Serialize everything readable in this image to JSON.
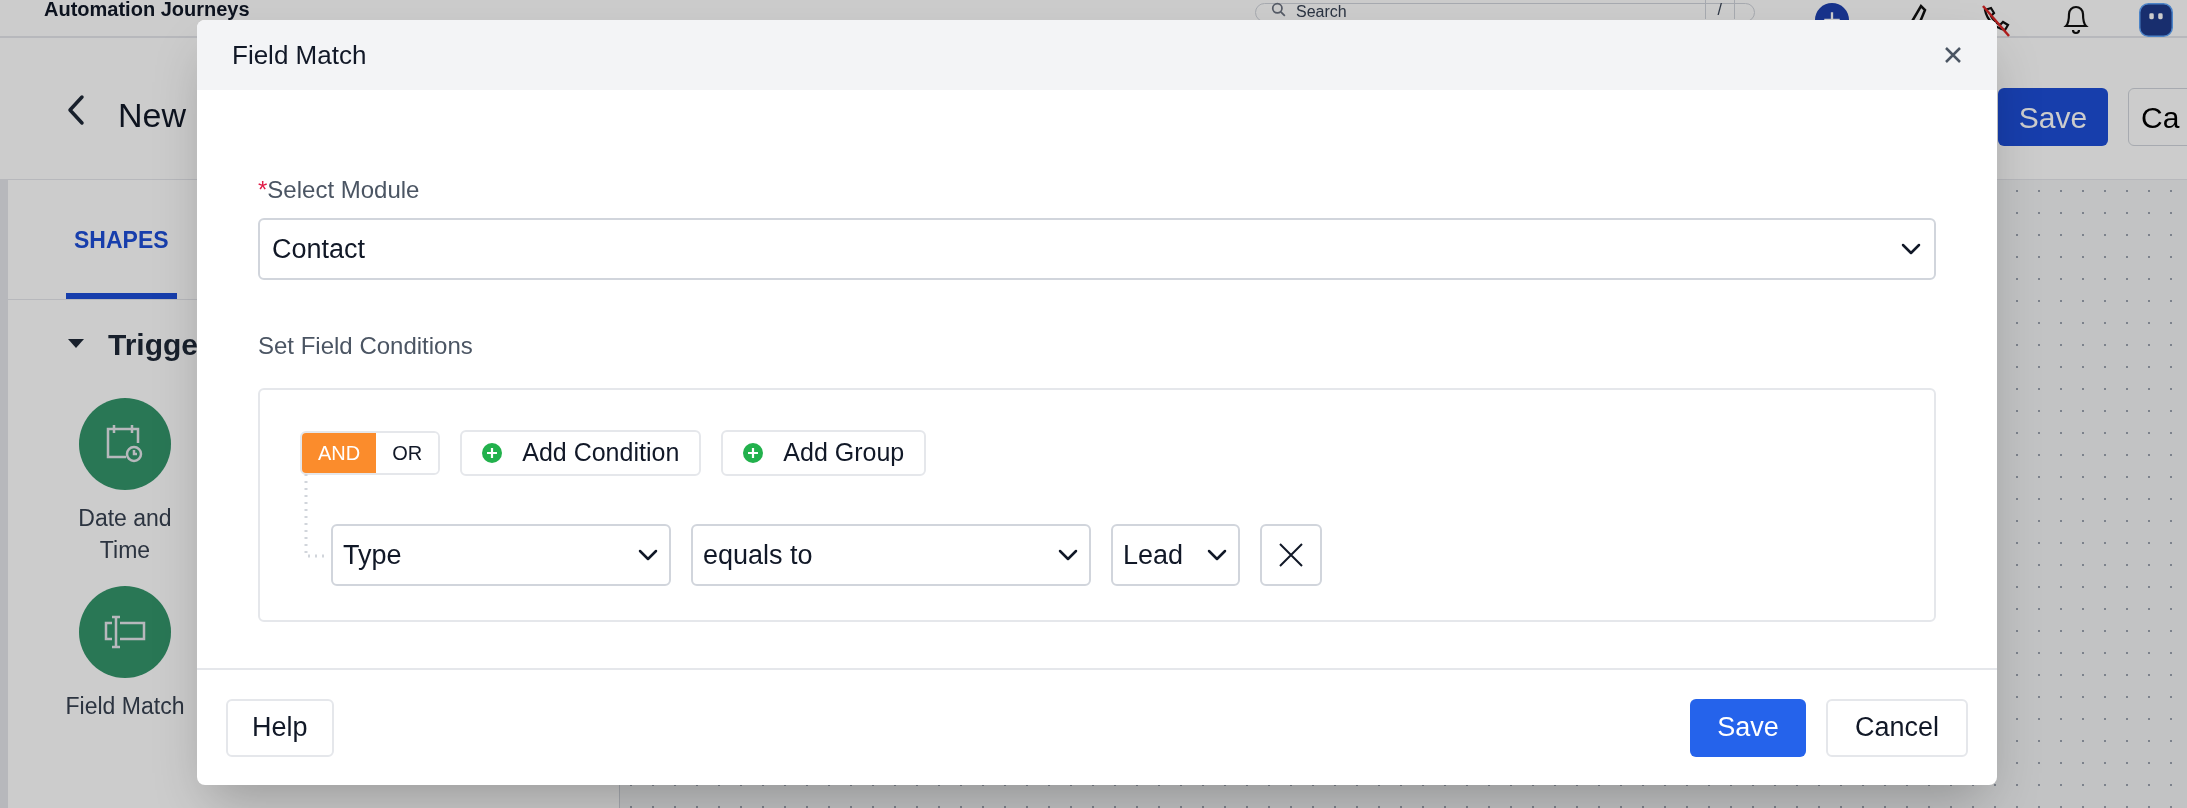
{
  "app_bar": {
    "title": "Automation Journeys",
    "search": {
      "placeholder": "Search",
      "shortcut": "/"
    }
  },
  "editor_bar": {
    "title": "New",
    "save": "Save",
    "cancel": "Ca"
  },
  "sidebar": {
    "tabs": [
      {
        "label": "SHAPES",
        "selected": true
      }
    ],
    "section": {
      "label": "Trigge",
      "expanded": true
    },
    "shapes": [
      {
        "kind": "calendar",
        "label": "Date and Time"
      },
      {
        "kind": "field",
        "label": "Field Match"
      }
    ]
  },
  "dialog": {
    "title": "Field Match",
    "module_label": "Select Module",
    "required_mark": "*",
    "module_value": "Contact",
    "conditions_label": "Set Field Conditions",
    "operators": [
      {
        "label": "AND",
        "selected": true
      },
      {
        "label": "OR",
        "selected": false
      }
    ],
    "actions": [
      "Add Condition",
      "Add Group"
    ],
    "rows": [
      {
        "field": "Type",
        "operator": "equals to",
        "value": "Lead"
      }
    ],
    "footer": {
      "help": "Help",
      "save": "Save",
      "cancel": "Cancel"
    }
  }
}
